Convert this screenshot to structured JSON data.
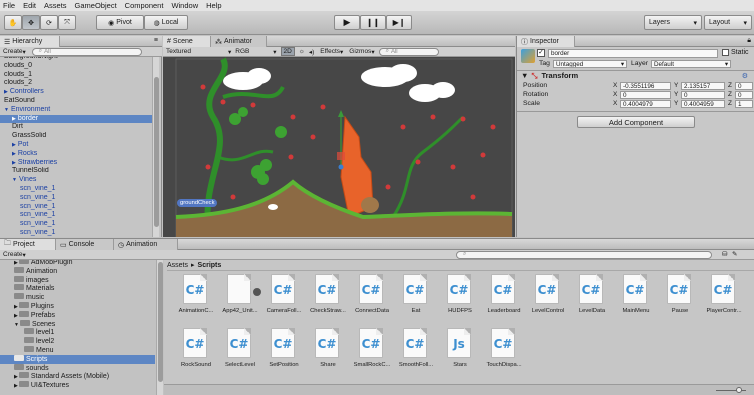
{
  "menu": [
    "File",
    "Edit",
    "Assets",
    "GameObject",
    "Component",
    "Window",
    "Help"
  ],
  "toolbar": {
    "pivot": "Pivot",
    "local": "Local",
    "layers": "Layers",
    "layout": "Layout"
  },
  "hierarchy": {
    "tab": "Hierarchy",
    "create": "Create",
    "search": "All",
    "rows": [
      {
        "label": "BackgroundNight",
        "indent": 0,
        "cls": ""
      },
      {
        "label": "clouds_0",
        "indent": 0,
        "cls": ""
      },
      {
        "label": "clouds_1",
        "indent": 0,
        "cls": ""
      },
      {
        "label": "clouds_2",
        "indent": 0,
        "cls": ""
      },
      {
        "label": "Controllers",
        "indent": 0,
        "cls": "blue",
        "arrow": "▶"
      },
      {
        "label": "EatSound",
        "indent": 0,
        "cls": ""
      },
      {
        "label": "Environment",
        "indent": 0,
        "cls": "blue",
        "arrow": "▼"
      },
      {
        "label": "border",
        "indent": 1,
        "cls": "sel-row",
        "arrow": "▶"
      },
      {
        "label": "Dirt",
        "indent": 1,
        "cls": ""
      },
      {
        "label": "GrassSolid",
        "indent": 1,
        "cls": ""
      },
      {
        "label": "Pot",
        "indent": 1,
        "cls": "blue",
        "arrow": "▶"
      },
      {
        "label": "Rocks",
        "indent": 1,
        "cls": "blue",
        "arrow": "▶"
      },
      {
        "label": "Strawberries",
        "indent": 1,
        "cls": "blue",
        "arrow": "▶"
      },
      {
        "label": "TunnelSolid",
        "indent": 1,
        "cls": ""
      },
      {
        "label": "Vines",
        "indent": 1,
        "cls": "blue",
        "arrow": "▼"
      },
      {
        "label": "scn_vine_1",
        "indent": 2,
        "cls": "blue"
      },
      {
        "label": "scn_vine_1",
        "indent": 2,
        "cls": "blue"
      },
      {
        "label": "scn_vine_1",
        "indent": 2,
        "cls": "blue"
      },
      {
        "label": "scn_vine_1",
        "indent": 2,
        "cls": "blue"
      },
      {
        "label": "scn_vine_1",
        "indent": 2,
        "cls": "blue"
      },
      {
        "label": "scn_vine_1",
        "indent": 2,
        "cls": "blue"
      },
      {
        "label": "VineMain",
        "indent": 2,
        "cls": "blue",
        "arrow": "▶"
      }
    ]
  },
  "scene": {
    "tab_scene": "Scene",
    "tab_animator": "Animator",
    "draw_mode": "Textured",
    "render_mode": "RGB",
    "mode_2d": "2D",
    "effects": "Effects",
    "gizmos": "Gizmos",
    "search": "All",
    "label_tag": "groundCheck"
  },
  "inspector": {
    "tab": "Inspector",
    "name": "border",
    "static": "Static",
    "tag_label": "Tag",
    "tag": "Untagged",
    "layer_label": "Layer",
    "layer": "Default",
    "component": "Transform",
    "position": {
      "label": "Position",
      "x": "-0.3551196",
      "y": "2.135157",
      "z": "0"
    },
    "rotation": {
      "label": "Rotation",
      "x": "0",
      "y": "0",
      "z": "0"
    },
    "scale": {
      "label": "Scale",
      "x": "0.4004979",
      "y": "0.4004959",
      "z": "1"
    },
    "add_component": "Add Component"
  },
  "project": {
    "tab_project": "Project",
    "tab_console": "Console",
    "tab_animation": "Animation",
    "create": "Create",
    "tree": [
      {
        "label": "AdMobPlugin",
        "indent": 1,
        "arrow": "▶"
      },
      {
        "label": "Animation",
        "indent": 1
      },
      {
        "label": "images",
        "indent": 1
      },
      {
        "label": "Materials",
        "indent": 1
      },
      {
        "label": "music",
        "indent": 1
      },
      {
        "label": "Plugins",
        "indent": 1,
        "arrow": "▶"
      },
      {
        "label": "Prefabs",
        "indent": 1,
        "arrow": "▶"
      },
      {
        "label": "Scenes",
        "indent": 1,
        "arrow": "▼"
      },
      {
        "label": "level1",
        "indent": 2
      },
      {
        "label": "level2",
        "indent": 2
      },
      {
        "label": "Menu",
        "indent": 2
      },
      {
        "label": "Scripts",
        "indent": 1,
        "sel": true
      },
      {
        "label": "sounds",
        "indent": 1
      },
      {
        "label": "Standard Assets (Mobile)",
        "indent": 1,
        "arrow": "▶"
      },
      {
        "label": "UI&Textures",
        "indent": 1,
        "arrow": "▶"
      }
    ],
    "breadcrumb": {
      "root": "Assets",
      "sep": "▸",
      "current": "Scripts"
    },
    "files_row1": [
      {
        "name": "AnimationC...",
        "glyph": "C#"
      },
      {
        "name": "App42_Unit...",
        "glyph": "",
        "pkg": true
      },
      {
        "name": "CameraFoll...",
        "glyph": "C#"
      },
      {
        "name": "CheckStraw...",
        "glyph": "C#"
      },
      {
        "name": "ConnectData",
        "glyph": "C#"
      },
      {
        "name": "Eat",
        "glyph": "C#"
      },
      {
        "name": "HUDFPS",
        "glyph": "C#"
      },
      {
        "name": "Leaderboard",
        "glyph": "C#"
      },
      {
        "name": "LevelControl",
        "glyph": "C#"
      },
      {
        "name": "LevelData",
        "glyph": "C#"
      },
      {
        "name": "MainMenu",
        "glyph": "C#"
      },
      {
        "name": "Pause",
        "glyph": "C#"
      },
      {
        "name": "PlayerContr...",
        "glyph": "C#"
      }
    ],
    "files_row2": [
      {
        "name": "RockSound",
        "glyph": "C#"
      },
      {
        "name": "SelectLevel",
        "glyph": "C#"
      },
      {
        "name": "SetPosition",
        "glyph": "C#"
      },
      {
        "name": "Share",
        "glyph": "C#"
      },
      {
        "name": "SmallRockC...",
        "glyph": "C#"
      },
      {
        "name": "SmoothFoll...",
        "glyph": "C#"
      },
      {
        "name": "Stars",
        "glyph": "Js"
      },
      {
        "name": "TouchDispa...",
        "glyph": "C#"
      }
    ]
  }
}
